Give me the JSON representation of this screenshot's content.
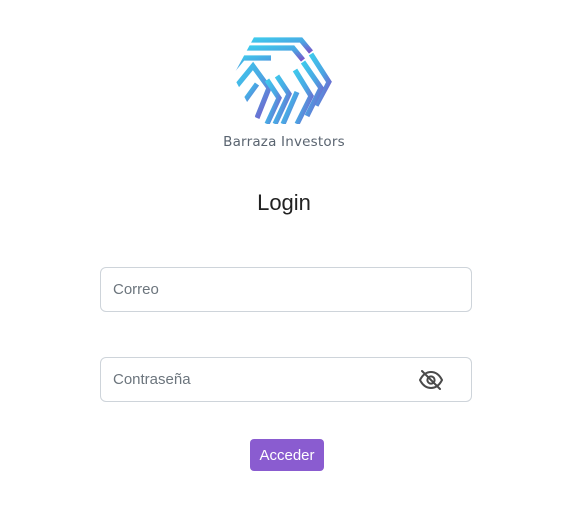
{
  "brand": {
    "name": "Barraza Investors",
    "logo_icon": "hexagon-logo-icon",
    "colors": {
      "gradient_start": "#3fc6ea",
      "gradient_end": "#7a56c9"
    }
  },
  "login": {
    "title": "Login",
    "email_placeholder": "Correo",
    "email_value": "",
    "password_placeholder": "Contraseña",
    "password_value": "",
    "toggle_icon": "eye-off-icon",
    "submit_label": "Acceder"
  },
  "colors": {
    "accent": "#8a5cd0",
    "input_border": "#ced4da"
  }
}
